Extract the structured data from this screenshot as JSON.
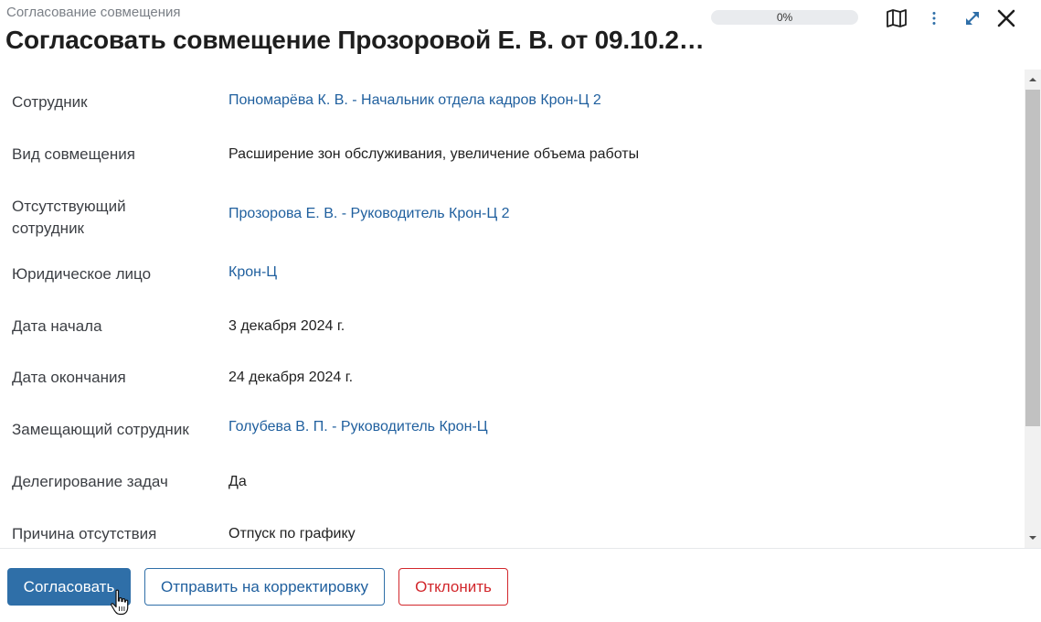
{
  "header": {
    "breadcrumb": "Согласование совмещения",
    "title": "Согласовать совмещение Прозоровой Е. В. от 09.10.2…",
    "progress_value": 0,
    "progress_label": "0%"
  },
  "toolbar_icons": [
    "map-icon",
    "more-vertical-icon",
    "expand-icon",
    "close-icon"
  ],
  "fields": [
    {
      "label": "Сотрудник",
      "value": "Пономарёва К. В. - Начальник отдела кадров Крон-Ц 2",
      "link": true
    },
    {
      "label": "Вид совмещения",
      "value": "Расширение зон обслуживания, увеличение объема работы",
      "link": false
    },
    {
      "label": "Отсутствующий сотрудник",
      "value": "Прозорова Е. В. - Руководитель Крон-Ц 2",
      "link": true
    },
    {
      "label": "Юридическое лицо",
      "value": "Крон-Ц",
      "link": true
    },
    {
      "label": "Дата начала",
      "value": "3 декабря 2024 г.",
      "link": false
    },
    {
      "label": "Дата окончания",
      "value": "24 декабря 2024 г.",
      "link": false
    },
    {
      "label": "Замещающий сотрудник",
      "value": "Голубева В. П. - Руководитель Крон-Ц",
      "link": true
    },
    {
      "label": "Делегирование задач",
      "value": "Да",
      "link": false
    },
    {
      "label": "Причина отсутствия",
      "value": "Отпуск по графику",
      "link": false
    }
  ],
  "actions": {
    "approve": "Согласовать",
    "send_back": "Отправить на корректировку",
    "reject": "Отклонить"
  },
  "colors": {
    "primary": "#2f6fa8",
    "link": "#1f5f9e",
    "danger": "#d2272c"
  }
}
